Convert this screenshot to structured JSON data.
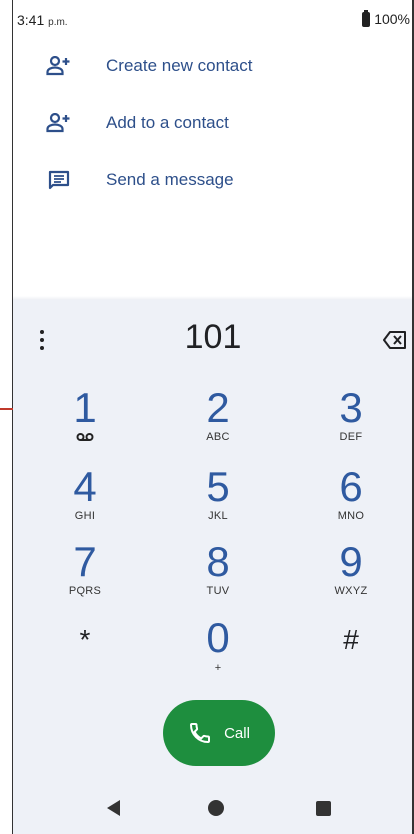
{
  "status_bar": {
    "time": "3:41",
    "time_suffix": "p.m.",
    "battery": "100%"
  },
  "actions": [
    {
      "label": "Create new contact",
      "icon": "person-add-icon"
    },
    {
      "label": "Add to a contact",
      "icon": "person-add-icon"
    },
    {
      "label": "Send a message",
      "icon": "message-icon"
    }
  ],
  "dialpad": {
    "number": "101",
    "keys": [
      {
        "digit": "1",
        "letters": "",
        "extra": "voicemail-icon"
      },
      {
        "digit": "2",
        "letters": "ABC"
      },
      {
        "digit": "3",
        "letters": "DEF"
      },
      {
        "digit": "4",
        "letters": "GHI"
      },
      {
        "digit": "5",
        "letters": "JKL"
      },
      {
        "digit": "6",
        "letters": "MNO"
      },
      {
        "digit": "7",
        "letters": "PQRS"
      },
      {
        "digit": "8",
        "letters": "TUV"
      },
      {
        "digit": "9",
        "letters": "WXYZ"
      },
      {
        "digit": "*",
        "letters": ""
      },
      {
        "digit": "0",
        "letters": "+"
      },
      {
        "digit": "#",
        "letters": ""
      }
    ],
    "call_label": "Call"
  },
  "colors": {
    "digit": "#2f5aa0",
    "call": "#1e8e3e",
    "background": "#eef1f7",
    "link": "#2d4f8a"
  }
}
